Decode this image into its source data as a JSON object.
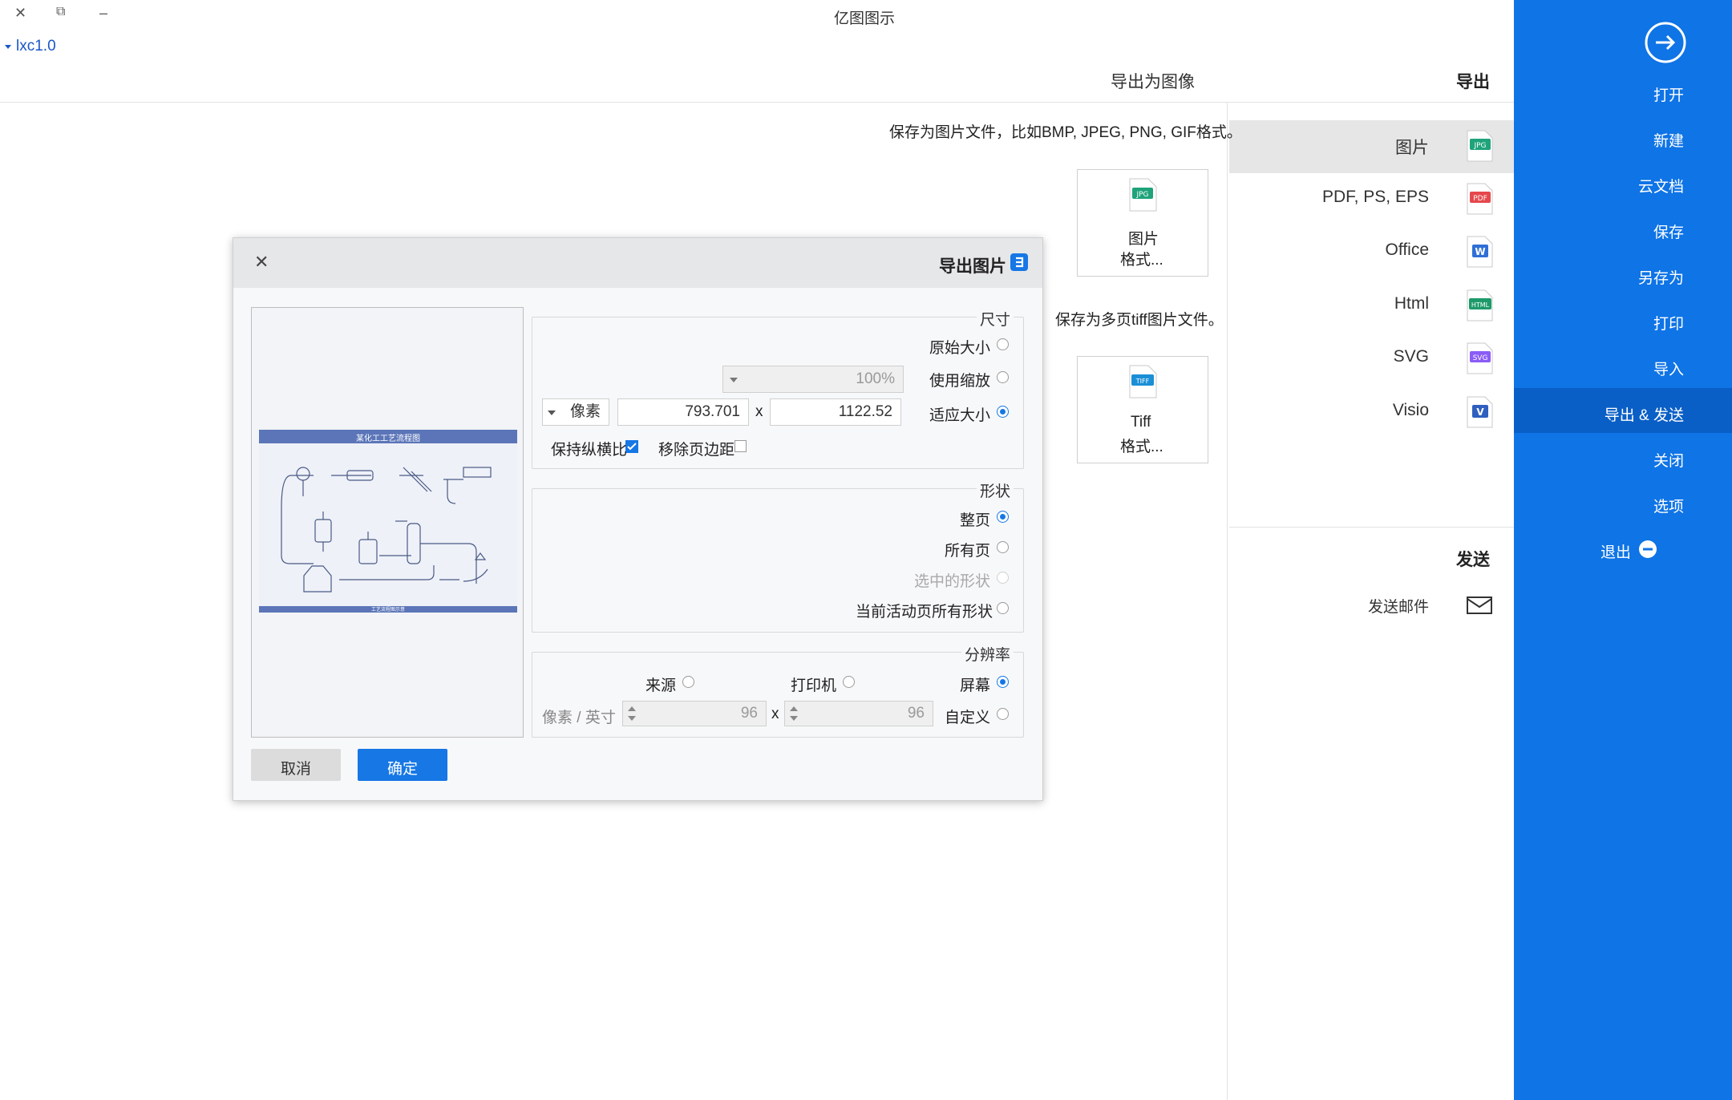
{
  "window": {
    "title": "亿图图示",
    "version": "lxc1.0",
    "controls": {
      "close": "✕",
      "restore": "⧉",
      "minimize": "–"
    }
  },
  "sidebar": {
    "items": [
      {
        "label": "打开"
      },
      {
        "label": "新建"
      },
      {
        "label": "云文档"
      },
      {
        "label": "保存"
      },
      {
        "label": "另存为"
      },
      {
        "label": "打印"
      },
      {
        "label": "导入"
      },
      {
        "label": "导出 & 发送"
      },
      {
        "label": "关闭"
      },
      {
        "label": "选项"
      },
      {
        "label": "退出"
      }
    ],
    "active_index": 7,
    "bg_color": "#0f74e6",
    "active_color": "#0a5fc6"
  },
  "export_panel": {
    "heading": "导出",
    "categories": [
      {
        "label": "图片",
        "badge": "JPG",
        "badge_color": "#1fa37a"
      },
      {
        "label": "PDF, PS, EPS",
        "badge": "PDF",
        "badge_color": "#e5484d"
      },
      {
        "label": "Office",
        "badge": "W",
        "badge_color": "#2f6fd6"
      },
      {
        "label": "Html",
        "badge": "HTML",
        "badge_color": "#1e9a6a"
      },
      {
        "label": "SVG",
        "badge": "SVG",
        "badge_color": "#8b5cf6"
      },
      {
        "label": "Visio",
        "badge": "V",
        "badge_color": "#2f5fbf"
      }
    ],
    "send_heading": "发送",
    "send_items": [
      {
        "label": "发送邮件"
      }
    ]
  },
  "content": {
    "heading": "导出为图像",
    "desc_image": "保存为图片文件，比如BMP, JPEG, PNG, GIF格式。",
    "image_card": {
      "line1": "图片",
      "line2": "格式...",
      "badge": "JPG"
    },
    "desc_tiff": "保存为多页tiff图片文件。",
    "tiff_card": {
      "line1": "Tiff",
      "line2": "格式...",
      "badge": "TIFF"
    }
  },
  "dialog": {
    "title": "导出图片",
    "close": "✕",
    "size_group": {
      "title": "尺寸",
      "original_label": "原始大小",
      "zoom_label": "使用缩放",
      "zoom_value": "100%",
      "fit_label": "适应大小",
      "width": "1122.52",
      "times": "x",
      "height": "793.701",
      "unit": "像素",
      "remove_margin_label": "移除页边距",
      "keep_ratio_label": "保持纵横比"
    },
    "shape_group": {
      "title": "形状",
      "whole_page": "整页",
      "all_pages": "所有页",
      "selected_shapes": "选中的形状",
      "current_page_shapes": "当前活动页所有形状"
    },
    "resolution_group": {
      "title": "分辨率",
      "screen": "屏幕",
      "printer": "打印机",
      "source": "来源",
      "custom": "自定义",
      "dpi_x": "96",
      "times": "x",
      "dpi_y": "96",
      "unit": "像素 / 英寸"
    },
    "preview": {
      "diagram_title": "某化工工艺流程图",
      "footer": "工艺流程图示意"
    },
    "ok_label": "确定",
    "cancel_label": "取消"
  }
}
